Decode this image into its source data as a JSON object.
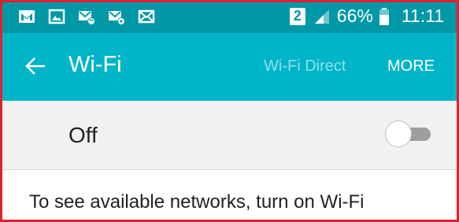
{
  "status_bar": {
    "icons_left": [
      "gmail-icon",
      "gallery-icon",
      "wifi-mail-icon",
      "sync-mail-icon",
      "mail-icon"
    ],
    "sim_number": "2",
    "battery_percent": "66%",
    "time": "11:11"
  },
  "app_bar": {
    "title": "Wi-Fi",
    "wifi_direct_label": "Wi-Fi Direct",
    "more_label": "MORE"
  },
  "wifi_toggle": {
    "label": "Off",
    "state": "off"
  },
  "hint_text": "To see available networks, turn on Wi-Fi",
  "colors": {
    "status_bar": "#0097a7",
    "app_bar": "#00b5c8",
    "row_background": "#f1f1f1",
    "frame_border": "#d9232e"
  }
}
